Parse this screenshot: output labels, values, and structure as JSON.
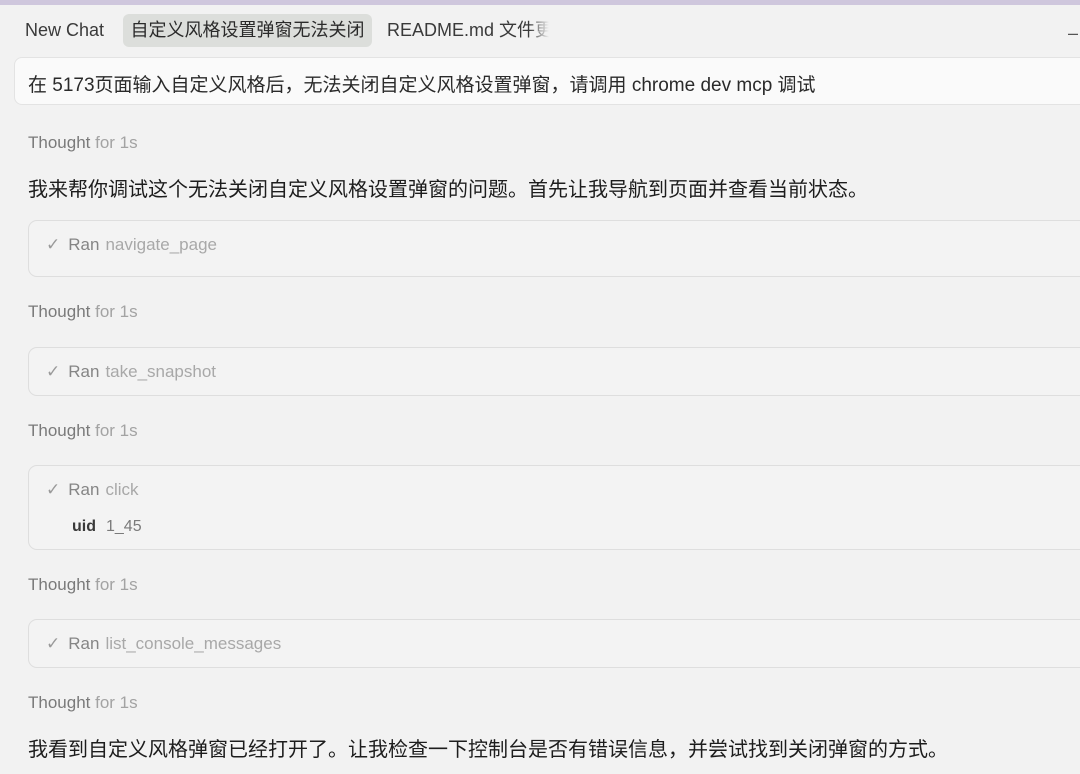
{
  "tabs": [
    {
      "label": "New Chat"
    },
    {
      "label": "自定义风格设置弹窗无法关闭"
    },
    {
      "label": "README.md 文件更"
    }
  ],
  "user_query": "在 5173页面输入自定义风格后，无法关闭自定义风格设置弹窗，请调用 chrome dev mcp 调试",
  "thought": {
    "label": "Thought",
    "duration": "for 1s"
  },
  "messages": [
    "我来帮你调试这个无法关闭自定义风格设置弹窗的问题。首先让我导航到页面并查看当前状态。",
    "我看到自定义风格弹窗已经打开了。让我检查一下控制台是否有错误信息，并尝试找到关闭弹窗的方式。"
  ],
  "tool_calls": [
    {
      "ran": "Ran",
      "name": "navigate_page"
    },
    {
      "ran": "Ran",
      "name": "take_snapshot"
    },
    {
      "ran": "Ran",
      "name": "click",
      "param_key": "uid",
      "param_value": "1_45"
    },
    {
      "ran": "Ran",
      "name": "list_console_messages"
    }
  ],
  "icons": {
    "check": "check-icon",
    "minus": "minus-icon"
  },
  "colors": {
    "background": "#f2f2f2",
    "active_tab": "#dcdedb",
    "top_line": "#cfc7dd"
  }
}
